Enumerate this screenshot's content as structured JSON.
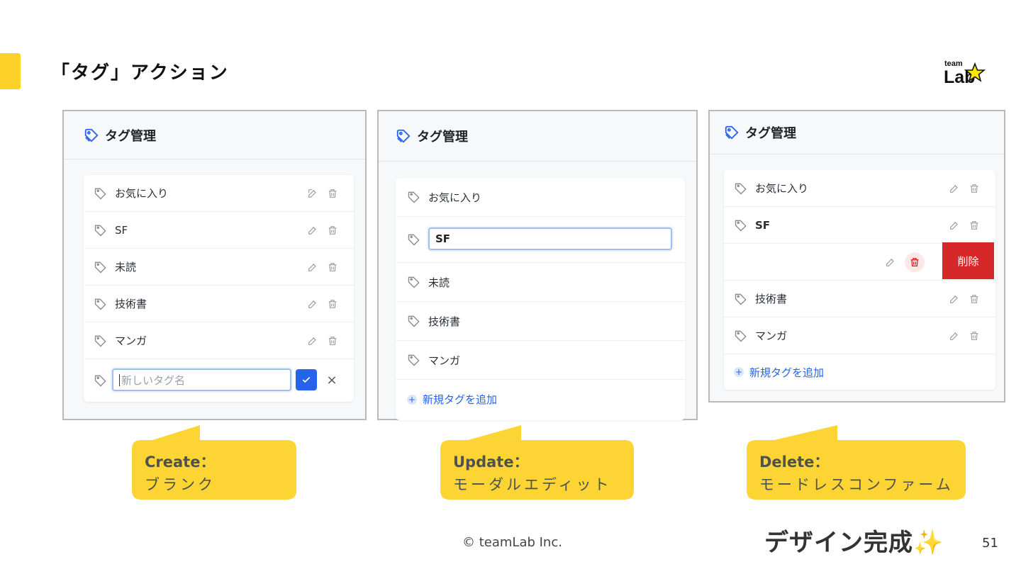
{
  "slide": {
    "title": "「タグ」アクション",
    "accent_color": "#fcd12a",
    "copyright": "© teamLab Inc.",
    "completion": "デザイン完成✨",
    "page_number": "51",
    "logo": {
      "top": "team",
      "bottom": "Lab",
      "star": "★"
    }
  },
  "panels": {
    "create": {
      "header": "タグ管理",
      "tags": [
        "お気に入り",
        "SF",
        "未読",
        "技術書",
        "マンガ"
      ],
      "new_input_placeholder": "新しいタグ名",
      "cancel_glyph": "×"
    },
    "update": {
      "header": "タグ管理",
      "tags": [
        "お気に入り",
        "SF",
        "未読",
        "技術書",
        "マンガ"
      ],
      "editing_value": "SF",
      "add_label": "新規タグを追加"
    },
    "delete": {
      "header": "タグ管理",
      "tags": [
        "お気に入り",
        "SF",
        "技術書",
        "マンガ"
      ],
      "delete_label": "削除",
      "add_label": "新規タグを追加"
    }
  },
  "callouts": {
    "create": {
      "head": "Create：",
      "sub": "ブランク"
    },
    "update": {
      "head": "Update：",
      "sub": "モーダルエディット"
    },
    "delete": {
      "head": "Delete：",
      "sub": "モードレスコンファーム"
    }
  },
  "colors": {
    "primary": "#2563eb",
    "danger": "#d62828",
    "callout": "#fcd535"
  }
}
